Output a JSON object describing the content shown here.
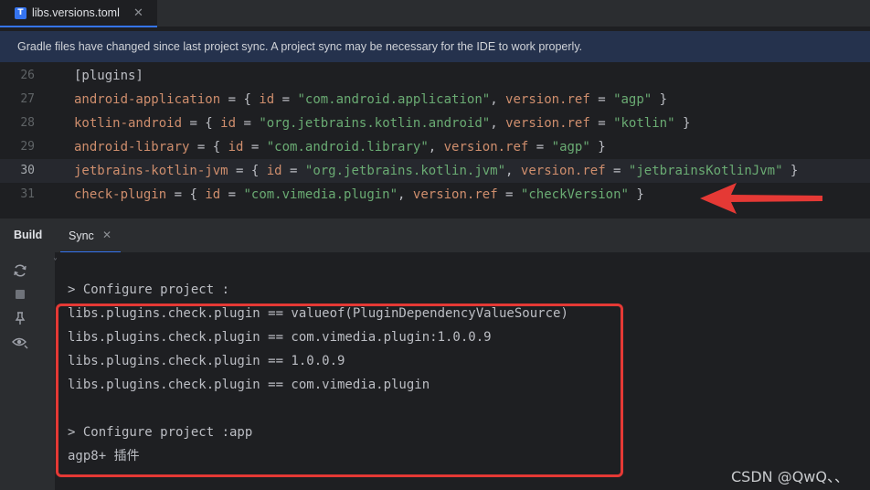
{
  "tab": {
    "icon": "toml-file-icon",
    "icon_letter": "T",
    "label": "libs.versions.toml",
    "close": "✕"
  },
  "banner": {
    "text": "Gradle files have changed since last project sync. A project sync may be necessary for the IDE to work properly."
  },
  "editor": {
    "lines": [
      {
        "num": "26",
        "parts": [
          [
            "br",
            "[plugins]"
          ]
        ]
      },
      {
        "num": "27",
        "parts": [
          [
            "k",
            "android-application"
          ],
          [
            "d",
            " = { "
          ],
          [
            "k",
            "id"
          ],
          [
            "d",
            " = "
          ],
          [
            "s",
            "\"com.android.application\""
          ],
          [
            "d",
            ", "
          ],
          [
            "k",
            "version.ref"
          ],
          [
            "d",
            " = "
          ],
          [
            "s",
            "\"agp\""
          ],
          [
            "d",
            " }"
          ]
        ]
      },
      {
        "num": "28",
        "parts": [
          [
            "k",
            "kotlin-android"
          ],
          [
            "d",
            " = { "
          ],
          [
            "k",
            "id"
          ],
          [
            "d",
            " = "
          ],
          [
            "s",
            "\"org.jetbrains.kotlin.android\""
          ],
          [
            "d",
            ", "
          ],
          [
            "k",
            "version.ref"
          ],
          [
            "d",
            " = "
          ],
          [
            "s",
            "\"kotlin\""
          ],
          [
            "d",
            " }"
          ]
        ]
      },
      {
        "num": "29",
        "parts": [
          [
            "k",
            "android-library"
          ],
          [
            "d",
            " = { "
          ],
          [
            "k",
            "id"
          ],
          [
            "d",
            " = "
          ],
          [
            "s",
            "\"com.android.library\""
          ],
          [
            "d",
            ", "
          ],
          [
            "k",
            "version.ref"
          ],
          [
            "d",
            " = "
          ],
          [
            "s",
            "\"agp\""
          ],
          [
            "d",
            " }"
          ]
        ]
      },
      {
        "num": "30",
        "current": true,
        "parts": [
          [
            "k",
            "jetbrains-kotlin-jvm"
          ],
          [
            "d",
            " = { "
          ],
          [
            "k",
            "id"
          ],
          [
            "d",
            " = "
          ],
          [
            "s",
            "\"org.jetbrains.kotlin.jvm\""
          ],
          [
            "d",
            ", "
          ],
          [
            "k",
            "version.ref"
          ],
          [
            "d",
            " = "
          ],
          [
            "s",
            "\"jetbrainsKotlinJvm\""
          ],
          [
            "d",
            " }"
          ]
        ]
      },
      {
        "num": "31",
        "parts": [
          [
            "k",
            "check-plugin"
          ],
          [
            "d",
            " = { "
          ],
          [
            "k",
            "id"
          ],
          [
            "d",
            " = "
          ],
          [
            "s",
            "\"com.vimedia.plugin\""
          ],
          [
            "d",
            ", "
          ],
          [
            "k",
            "version.ref"
          ],
          [
            "d",
            " = "
          ],
          [
            "s",
            "\"checkVersion\""
          ],
          [
            "d",
            " }"
          ]
        ]
      }
    ]
  },
  "panel": {
    "title": "Build",
    "tab_label": "Sync",
    "tab_close": "✕",
    "tools": [
      "sync-icon",
      "stop-icon",
      "pin-icon",
      "eye-icon"
    ]
  },
  "console": {
    "lines": [
      "> Configure project :",
      "libs.plugins.check.plugin == valueof(PluginDependencyValueSource)",
      "libs.plugins.check.plugin == com.vimedia.plugin:1.0.0.9",
      "libs.plugins.check.plugin == 1.0.0.9",
      "libs.plugins.check.plugin == com.vimedia.plugin",
      "",
      "> Configure project :app",
      "agp8+ 插件"
    ]
  },
  "watermark": "CSDN @QwQ、、",
  "colors": {
    "accent": "#3574f0",
    "annotation_red": "#e53935",
    "keyword": "#cf8e6d",
    "string": "#6aab73"
  }
}
